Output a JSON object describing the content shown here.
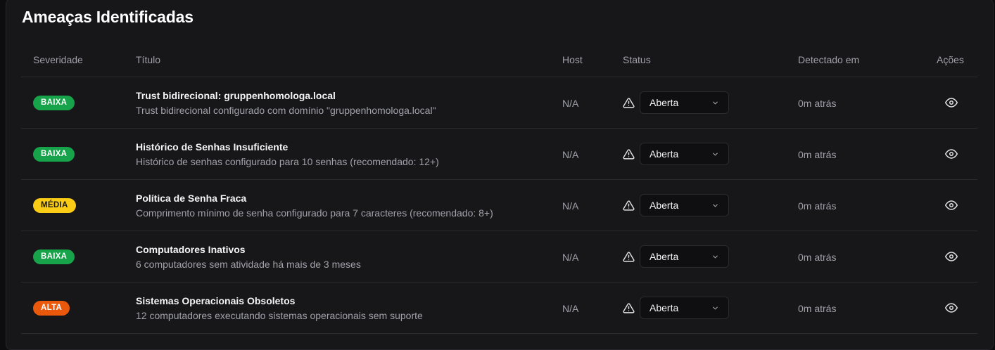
{
  "title": "Ameaças Identificadas",
  "columns": {
    "severity": "Severidade",
    "title": "Título",
    "host": "Host",
    "status": "Status",
    "detected": "Detectado em",
    "actions": "Ações"
  },
  "rows": [
    {
      "severity": "BAIXA",
      "severity_level": "baixa",
      "title": "Trust bidirecional: gruppenhomologa.local",
      "description": "Trust bidirecional configurado com domínio \"gruppenhomologa.local\"",
      "host": "N/A",
      "status": "Aberta",
      "detected": "0m atrás",
      "status_icon": "alert-triangle-icon",
      "action_icon": "eye-icon"
    },
    {
      "severity": "BAIXA",
      "severity_level": "baixa",
      "title": "Histórico de Senhas Insuficiente",
      "description": "Histórico de senhas configurado para 10 senhas (recomendado: 12+)",
      "host": "N/A",
      "status": "Aberta",
      "detected": "0m atrás",
      "status_icon": "alert-triangle-icon",
      "action_icon": "eye-icon"
    },
    {
      "severity": "MÉDIA",
      "severity_level": "media",
      "title": "Política de Senha Fraca",
      "description": "Comprimento mínimo de senha configurado para 7 caracteres (recomendado: 8+)",
      "host": "N/A",
      "status": "Aberta",
      "detected": "0m atrás",
      "status_icon": "alert-triangle-icon",
      "action_icon": "eye-icon"
    },
    {
      "severity": "BAIXA",
      "severity_level": "baixa",
      "title": "Computadores Inativos",
      "description": "6 computadores sem atividade há mais de 3 meses",
      "host": "N/A",
      "status": "Aberta",
      "detected": "0m atrás",
      "status_icon": "alert-triangle-icon",
      "action_icon": "eye-icon"
    },
    {
      "severity": "ALTA",
      "severity_level": "alta",
      "title": "Sistemas Operacionais Obsoletos",
      "description": "12 computadores executando sistemas operacionais sem suporte",
      "host": "N/A",
      "status": "Aberta",
      "detected": "0m atrás",
      "status_icon": "alert-triangle-icon",
      "action_icon": "eye-icon"
    }
  ],
  "colors": {
    "baixa": "#16a34a",
    "media": "#facc15",
    "alta": "#ea580c",
    "background": "#17171a"
  }
}
